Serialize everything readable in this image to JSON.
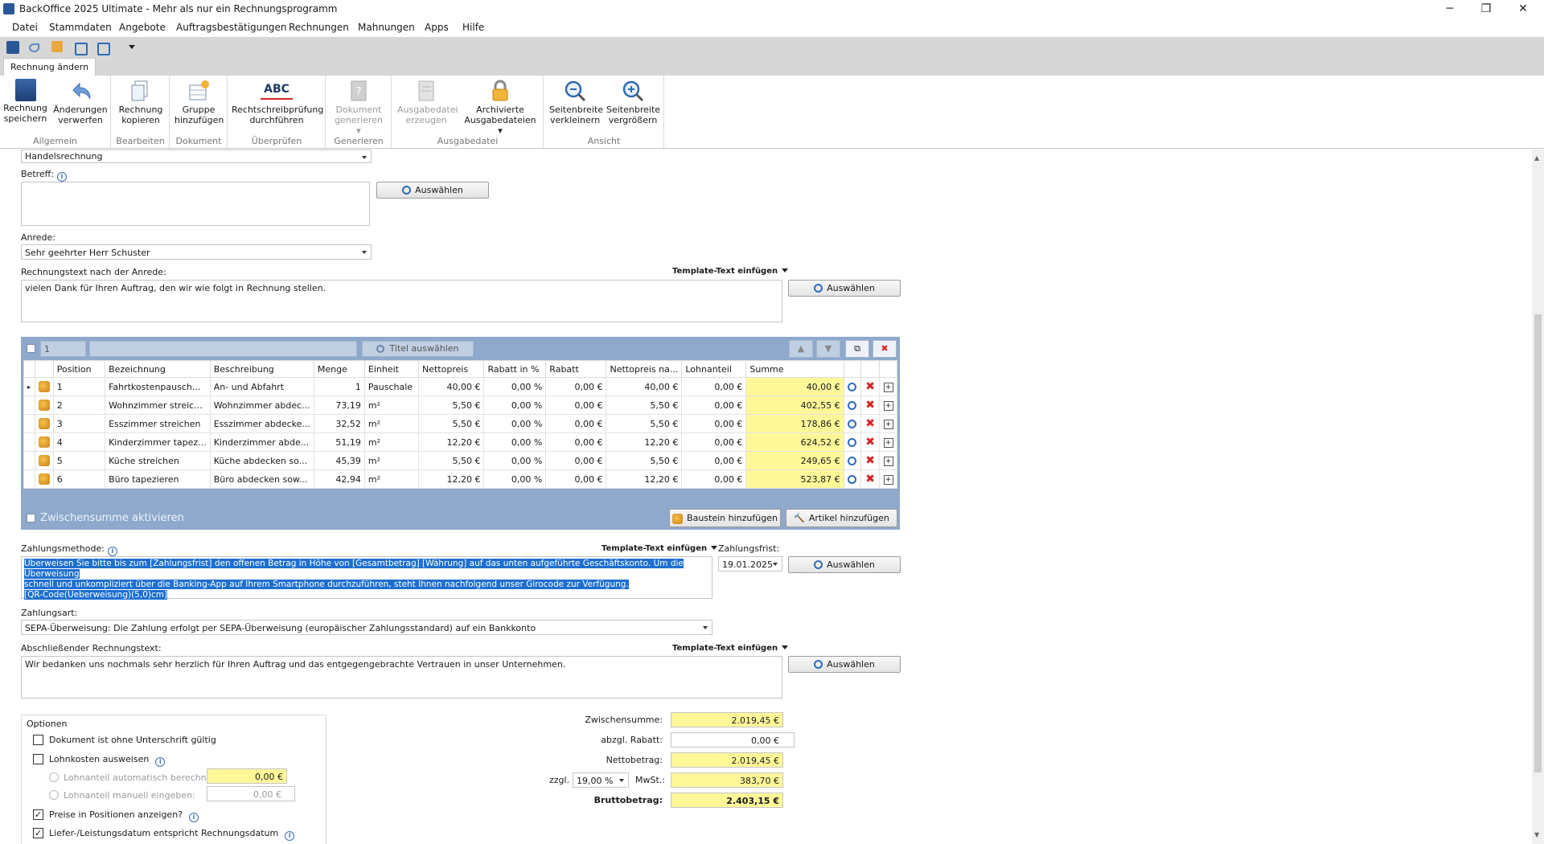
{
  "window": {
    "title": "BackOffice 2025 Ultimate - Mehr als nur ein Rechnungsprogramm",
    "minimize": "─",
    "maximize": "❐",
    "close": "✕"
  },
  "menu": [
    "Datei",
    "Stammdaten",
    "Angebote",
    "Auftragsbestätigungen",
    "Rechnungen",
    "Mahnungen",
    "Apps",
    "Hilfe"
  ],
  "quick_access": [
    "save-icon",
    "undo-icon",
    "template-icon",
    "zoom-out-icon",
    "zoom-in-icon",
    "customize-dropdown-icon"
  ],
  "tab": "Rechnung ändern",
  "ribbon": {
    "groups": [
      "Allgemein",
      "Bearbeiten",
      "Dokument",
      "Überprüfen",
      "Generieren",
      "Ausgabedatei",
      "Ansicht"
    ],
    "buttons": [
      {
        "l1": "Rechnung",
        "l2": "speichern"
      },
      {
        "l1": "Änderungen",
        "l2": "verwerfen"
      },
      {
        "l1": "Rechnung",
        "l2": "kopieren"
      },
      {
        "l1": "Gruppe",
        "l2": "hinzufügen"
      },
      {
        "l1": "Rechtschreibprüfung",
        "l2": "durchführen",
        "icon_text": "ABC"
      },
      {
        "l1": "Dokument",
        "l2": "generieren ▾"
      },
      {
        "l1": "Ausgabedatei",
        "l2": "erzeugen"
      },
      {
        "l1": "Archivierte",
        "l2": "Ausgabedateien ▾"
      },
      {
        "l1": "Seitenbreite",
        "l2": "verkleinern"
      },
      {
        "l1": "Seitenbreite",
        "l2": "vergrößern"
      }
    ]
  },
  "form": {
    "doc_type": "Handelsrechnung",
    "betreff_label": "Betreff:",
    "betreff_value": "",
    "select_label": "Auswählen",
    "anrede_label": "Anrede:",
    "anrede_value": "Sehr geehrter Herr Schuster",
    "text_after_label": "Rechnungstext nach der Anrede:",
    "template_label": "Template-Text einfügen",
    "text_after_value": "vielen Dank für Ihren Auftrag, den wir wie folgt in Rechnung stellen.",
    "zahlungsmethode_label": "Zahlungsmethode:",
    "zahlungsmethode_lines": [
      "Überweisen Sie bitte bis zum [Zahlungsfrist] den offenen Betrag in Höhe von [Gesamtbetrag] [Währung] auf das unten aufgeführte Geschäftskonto. Um die Überweisung",
      "schnell und unkompliziert über die Banking-App auf Ihrem Smartphone durchzuführen, steht Ihnen nachfolgend unser Girocode zur Verfügung.",
      "[QR-Code(Ueberweisung)(5,0)cm]"
    ],
    "zahlungsfrist_label": "Zahlungsfrist:",
    "zahlungsfrist_value": "19.01.2025",
    "zahlungsart_label": "Zahlungsart:",
    "zahlungsart_value": "SEPA-Überweisung: Die Zahlung erfolgt per SEPA-Überweisung (europäischer Zahlungsstandard) auf ein Bankkonto",
    "abschluss_label": "Abschließender Rechnungstext:",
    "abschluss_value": "Wir bedanken uns nochmals sehr herzlich für Ihren Auftrag und das entgegengebrachte Vertrauen in unser Unternehmen."
  },
  "grid": {
    "page_field": "1",
    "title_button": "Titel auswählen",
    "columns": [
      "Position",
      "Bezeichnung",
      "Beschreibung",
      "Menge",
      "Einheit",
      "Nettopreis",
      "Rabatt in %",
      "Rabatt",
      "Nettopreis na...",
      "Lohnanteil",
      "Summe"
    ],
    "rows": [
      {
        "pos": "1",
        "bez": "Fahrtkostenpausch...",
        "besch": "An- und Abfahrt",
        "menge": "1",
        "einheit": "Pauschale",
        "netto": "40,00 €",
        "rabp": "0,00 %",
        "rab": "0,00 €",
        "nettona": "40,00 €",
        "lohn": "0,00 €",
        "summe": "40,00 €"
      },
      {
        "pos": "2",
        "bez": "Wohnzimmer streic...",
        "besch": "Wohnzimmer abdec...",
        "menge": "73,19",
        "einheit": "m²",
        "netto": "5,50 €",
        "rabp": "0,00 %",
        "rab": "0,00 €",
        "nettona": "5,50 €",
        "lohn": "0,00 €",
        "summe": "402,55 €"
      },
      {
        "pos": "3",
        "bez": "Esszimmer streichen",
        "besch": "Esszimmer abdecke...",
        "menge": "32,52",
        "einheit": "m²",
        "netto": "5,50 €",
        "rabp": "0,00 %",
        "rab": "0,00 €",
        "nettona": "5,50 €",
        "lohn": "0,00 €",
        "summe": "178,86 €"
      },
      {
        "pos": "4",
        "bez": "Kinderzimmer tapez...",
        "besch": "Kinderzimmer abde...",
        "menge": "51,19",
        "einheit": "m²",
        "netto": "12,20 €",
        "rabp": "0,00 %",
        "rab": "0,00 €",
        "nettona": "12,20 €",
        "lohn": "0,00 €",
        "summe": "624,52 €"
      },
      {
        "pos": "5",
        "bez": "Küche streichen",
        "besch": "Küche abdecken so...",
        "menge": "45,39",
        "einheit": "m²",
        "netto": "5,50 €",
        "rabp": "0,00 %",
        "rab": "0,00 €",
        "nettona": "5,50 €",
        "lohn": "0,00 €",
        "summe": "249,65 €"
      },
      {
        "pos": "6",
        "bez": "Büro tapezieren",
        "besch": "Büro abdecken sow...",
        "menge": "42,94",
        "einheit": "m²",
        "netto": "12,20 €",
        "rabp": "0,00 %",
        "rab": "0,00 €",
        "nettona": "12,20 €",
        "lohn": "0,00 €",
        "summe": "523,87 €"
      }
    ],
    "subtotal_toggle": "Zwischensumme aktivieren",
    "add_block": "Baustein hinzufügen",
    "add_article": "Artikel hinzufügen"
  },
  "options": {
    "title": "Optionen",
    "items": [
      "Dokument ist ohne Unterschrift gültig",
      "Lohnkosten ausweisen",
      "Lohnanteil automatisch berechnen:",
      "Lohnanteil manuell eingeben:",
      "Preise in Positionen anzeigen?",
      "Liefer-/Leistungsdatum entspricht Rechnungsdatum"
    ],
    "checked": [
      false,
      false,
      false,
      false,
      true,
      true
    ],
    "lohn_auto_value": "0,00 €",
    "lohn_manual_value": "0,00 €"
  },
  "totals": {
    "zwischensumme_label": "Zwischensumme:",
    "zwischensumme": "2.019,45 €",
    "rabatt_label": "abzgl. Rabatt:",
    "rabatt": "0,00 €",
    "netto_label": "Nettobetrag:",
    "netto": "2.019,45 €",
    "zzgl_label": "zzgl.",
    "mwst_rate": "19,00 %",
    "mwst_label": "MwSt.:",
    "mwst": "383,70 €",
    "brutto_label": "Bruttobetrag:",
    "brutto": "2.403,15 €"
  },
  "colors": {
    "accent": "#1e6fd0",
    "highlight_yellow": "#fff899",
    "grid_frame": "#8ea9cc",
    "delete_red": "#d42424"
  }
}
